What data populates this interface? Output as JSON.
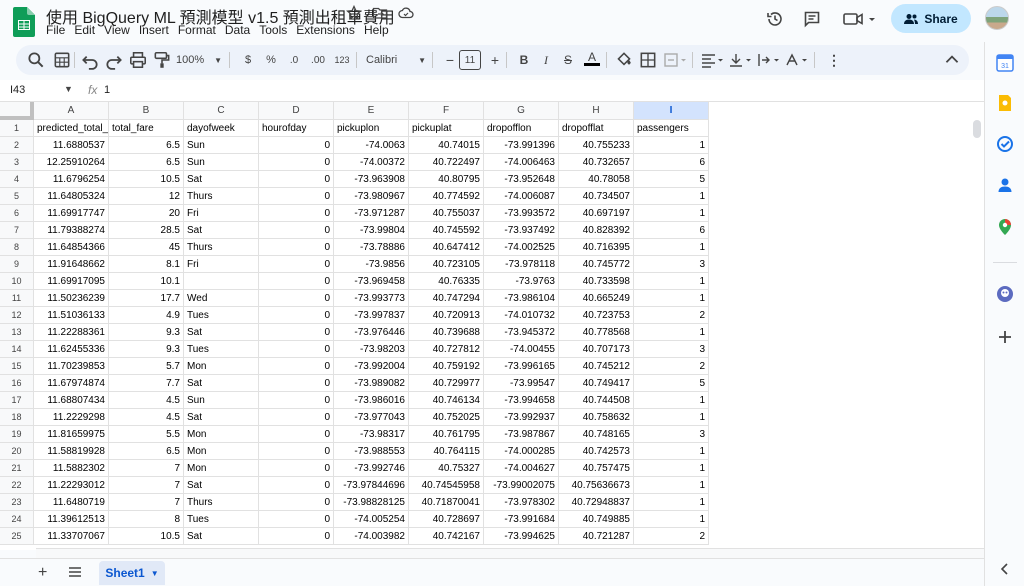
{
  "header": {
    "title": "使用 BigQuery ML 預測模型 v1.5 預測出租車費用",
    "menu": [
      "File",
      "Edit",
      "View",
      "Insert",
      "Format",
      "Data",
      "Tools",
      "Extensions",
      "Help"
    ],
    "share_label": "Share"
  },
  "toolbar": {
    "zoom": "100%",
    "currency": "$",
    "percent": "%",
    "decimal_decrease": ".0",
    "decimal_increase": ".00",
    "number_format": "123",
    "font": "Calibri",
    "font_size": "11"
  },
  "formula_bar": {
    "name_box": "I43",
    "fx": "fx",
    "value": "1"
  },
  "columns": [
    "A",
    "B",
    "C",
    "D",
    "E",
    "F",
    "G",
    "H",
    "I"
  ],
  "selected_column": "I",
  "rows": [
    [
      "predicted_total_",
      "total_fare",
      "dayofweek",
      "hourofday",
      "pickuplon",
      "pickuplat",
      "dropofflon",
      "dropofflat",
      "passengers"
    ],
    [
      "11.6880537",
      "6.5",
      "Sun",
      "0",
      "-74.0063",
      "40.74015",
      "-73.991396",
      "40.755233",
      "1"
    ],
    [
      "12.25910264",
      "6.5",
      "Sun",
      "0",
      "-74.00372",
      "40.722497",
      "-74.006463",
      "40.732657",
      "6"
    ],
    [
      "11.6796254",
      "10.5",
      "Sat",
      "0",
      "-73.963908",
      "40.80795",
      "-73.952648",
      "40.78058",
      "5"
    ],
    [
      "11.64805324",
      "12",
      "Thurs",
      "0",
      "-73.980967",
      "40.774592",
      "-74.006087",
      "40.734507",
      "1"
    ],
    [
      "11.69917747",
      "20",
      "Fri",
      "0",
      "-73.971287",
      "40.755037",
      "-73.993572",
      "40.697197",
      "1"
    ],
    [
      "11.79388274",
      "28.5",
      "Sat",
      "0",
      "-73.99804",
      "40.745592",
      "-73.937492",
      "40.828392",
      "6"
    ],
    [
      "11.64854366",
      "45",
      "Thurs",
      "0",
      "-73.78886",
      "40.647412",
      "-74.002525",
      "40.716395",
      "1"
    ],
    [
      "11.91648662",
      "8.1",
      "Fri",
      "0",
      "-73.9856",
      "40.723105",
      "-73.978118",
      "40.745772",
      "3"
    ],
    [
      "11.69917095",
      "10.1",
      "",
      "0",
      "-73.969458",
      "40.76335",
      "-73.9763",
      "40.733598",
      "1"
    ],
    [
      "11.50236239",
      "17.7",
      "Wed",
      "0",
      "-73.993773",
      "40.747294",
      "-73.986104",
      "40.665249",
      "1"
    ],
    [
      "11.51036133",
      "4.9",
      "Tues",
      "0",
      "-73.997837",
      "40.720913",
      "-74.010732",
      "40.723753",
      "2"
    ],
    [
      "11.22288361",
      "9.3",
      "Sat",
      "0",
      "-73.976446",
      "40.739688",
      "-73.945372",
      "40.778568",
      "1"
    ],
    [
      "11.62455336",
      "9.3",
      "Tues",
      "0",
      "-73.98203",
      "40.727812",
      "-74.00455",
      "40.707173",
      "3"
    ],
    [
      "11.70239853",
      "5.7",
      "Mon",
      "0",
      "-73.992004",
      "40.759192",
      "-73.996165",
      "40.745212",
      "2"
    ],
    [
      "11.67974874",
      "7.7",
      "Sat",
      "0",
      "-73.989082",
      "40.729977",
      "-73.99547",
      "40.749417",
      "5"
    ],
    [
      "11.68807434",
      "4.5",
      "Sun",
      "0",
      "-73.986016",
      "40.746134",
      "-73.994658",
      "40.744508",
      "1"
    ],
    [
      "11.2229298",
      "4.5",
      "Sat",
      "0",
      "-73.977043",
      "40.752025",
      "-73.992937",
      "40.758632",
      "1"
    ],
    [
      "11.81659975",
      "5.5",
      "Mon",
      "0",
      "-73.98317",
      "40.761795",
      "-73.987867",
      "40.748165",
      "3"
    ],
    [
      "11.58819928",
      "6.5",
      "Mon",
      "0",
      "-73.988553",
      "40.764115",
      "-74.000285",
      "40.742573",
      "1"
    ],
    [
      "11.5882302",
      "7",
      "Mon",
      "0",
      "-73.992746",
      "40.75327",
      "-74.004627",
      "40.757475",
      "1"
    ],
    [
      "11.22293012",
      "7",
      "Sat",
      "0",
      "-73.97844696",
      "40.74545958",
      "-73.99002075",
      "40.75636673",
      "1"
    ],
    [
      "11.6480719",
      "7",
      "Thurs",
      "0",
      "-73.98828125",
      "40.71870041",
      "-73.978302",
      "40.72948837",
      "1"
    ],
    [
      "11.39612513",
      "8",
      "Tues",
      "0",
      "-74.005254",
      "40.728697",
      "-73.991684",
      "40.749885",
      "1"
    ],
    [
      "11.33707067",
      "10.5",
      "Sat",
      "0",
      "-74.003982",
      "40.742167",
      "-73.994625",
      "40.721287",
      "2"
    ]
  ],
  "sheet": {
    "name": "Sheet1"
  },
  "colors": {
    "accent": "#0b57d0",
    "share_bg": "#c2e7ff",
    "selected_header": "#d3e3fd"
  }
}
